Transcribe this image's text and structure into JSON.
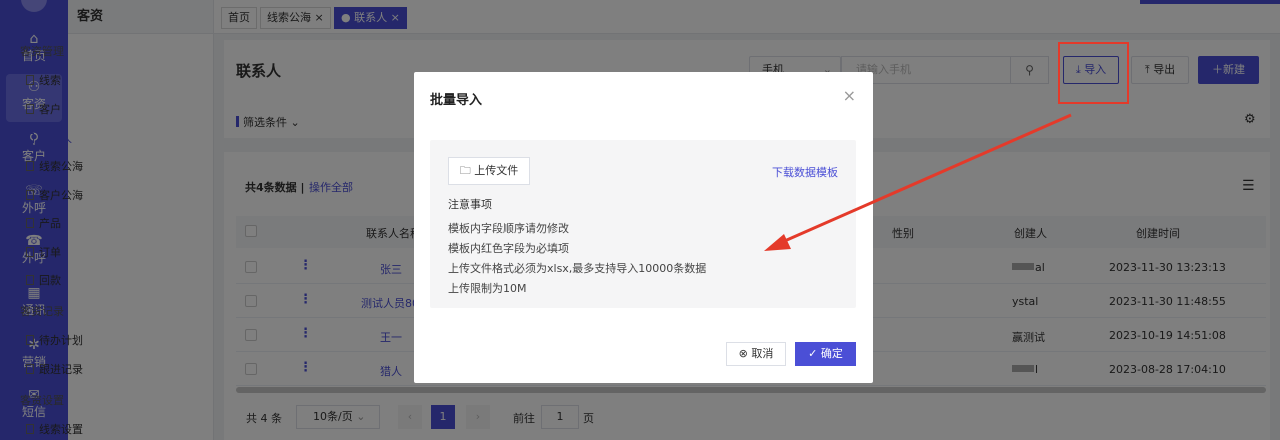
{
  "rail": {
    "items": [
      {
        "icon": "home-icon",
        "glyph": "⌂",
        "label": "首页"
      },
      {
        "icon": "users-icon",
        "glyph": "⚇",
        "label": "客资"
      },
      {
        "icon": "person-icon",
        "glyph": "⚲",
        "label": "客户"
      },
      {
        "icon": "phone-icon",
        "glyph": "☏",
        "label": "外呼"
      },
      {
        "icon": "phone-outgoing-icon",
        "glyph": "☎",
        "label": "外呼"
      },
      {
        "icon": "contacts-icon",
        "glyph": "▦",
        "label": "通讯"
      },
      {
        "icon": "marketing-icon",
        "glyph": "✲",
        "label": "营销"
      },
      {
        "icon": "sms-icon",
        "glyph": "✉",
        "label": "短信"
      }
    ]
  },
  "sidebar": {
    "title": "客资",
    "groups": [
      {
        "label": "客资管理",
        "items": [
          "线索",
          "客户",
          "联系人",
          "线索公海",
          "客户公海",
          "产品",
          "订单",
          "回款"
        ]
      },
      {
        "label": "客资记录",
        "items": [
          "待办计划",
          "跟进记录"
        ]
      },
      {
        "label": "客资设置",
        "items": [
          "线索设置"
        ]
      }
    ],
    "active": "联系人"
  },
  "tabs": [
    {
      "label": "首页"
    },
    {
      "label": "线索公海 ×"
    },
    {
      "label": "● 联系人 ×"
    }
  ],
  "header": {
    "title": "联系人",
    "search_field": "手机",
    "search_placeholder": "请输入手机",
    "import_label": "导入",
    "export_label": "导出",
    "new_label": "新建",
    "filter_label": "筛选条件"
  },
  "table": {
    "summary": "共4条数据",
    "separator": "|",
    "op_all": "操作全部",
    "columns": [
      "联系人名称",
      "性别",
      "创建人",
      "创建时间"
    ],
    "rows": [
      {
        "name": "张三",
        "creator": "al",
        "created": "2023-11-30 13:23:13"
      },
      {
        "name": "测试人员80",
        "creator": "ystal",
        "created": "2023-11-30 11:48:55"
      },
      {
        "name": "王一",
        "creator": "赢测试",
        "created": "2023-10-19 14:51:08"
      },
      {
        "name": "猎人",
        "creator": "l",
        "created": "2023-08-28 17:04:10"
      }
    ]
  },
  "pager": {
    "total": "共 4 条",
    "page_size": "10条/页",
    "current": "1",
    "goto_label": "前往",
    "goto_value": "1",
    "page_suffix": "页"
  },
  "modal": {
    "title": "批量导入",
    "upload_label": "上传文件",
    "download_link": "下载数据模板",
    "notes_title": "注意事项",
    "notes": [
      "模板内字段顺序请勿修改",
      "模板内红色字段为必填项",
      "上传文件格式必须为xlsx,最多支持导入10000条数据",
      "上传限制为10M"
    ],
    "cancel_label": "取消",
    "ok_label": "确定"
  },
  "colors": {
    "accent": "#4b4fd6",
    "annotation": "#e43a2a"
  }
}
